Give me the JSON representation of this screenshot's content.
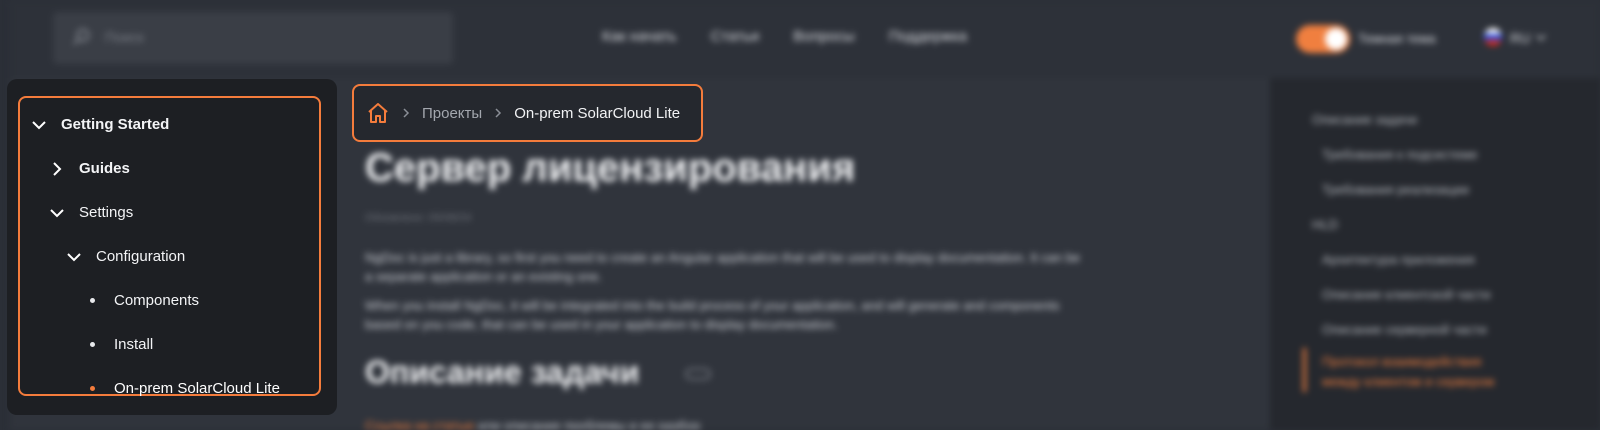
{
  "header": {
    "search_placeholder": "Поиск",
    "nav": [
      "Как начать",
      "Статьи",
      "Вопросы",
      "Поддержка"
    ],
    "theme_label": "Темная тема",
    "language": "RU"
  },
  "breadcrumb": {
    "items": [
      "Проекты",
      "On-prem SolarCloud Lite"
    ]
  },
  "sidebar": {
    "items": [
      {
        "label": "Getting Started",
        "state": "expanded"
      },
      {
        "label": "Guides",
        "state": "collapsed"
      },
      {
        "label": "Settings",
        "state": "expanded"
      },
      {
        "label": "Configuration",
        "state": "expanded"
      },
      {
        "label": "Components",
        "state": "leaf"
      },
      {
        "label": "Install",
        "state": "leaf"
      },
      {
        "label": "On-prem SolarCloud Lite",
        "state": "leaf-active"
      }
    ]
  },
  "content": {
    "title": "Сервер лицензирования",
    "updated": "Обновлено: 05/08/24",
    "paragraphs": [
      "NgDoc is just a library, so first you need to create an Angular application that will be used to display documentation. It can be a separate application or an existing one.",
      "When you install NgDoc, it will be integrated into the build process of your application, and will generate and components based on you code, that can be used in your application to display documentation."
    ],
    "section_title": "Описание задачи",
    "section_intro_link": "Ссылка на статью",
    "section_intro_rest": "или описание проблемы и ее разбор"
  },
  "toc": {
    "items": [
      "Описание задачи",
      "Требования к подсистеме",
      "Требования реализации",
      "HLD",
      "Архитектура приложения",
      "Описание клиентской части",
      "Описание серверной части",
      "Протокол взаимодействия",
      "между клиентом и сервером"
    ]
  },
  "colors": {
    "accent": "#f47c3c",
    "background": "#2b2f37",
    "sidebar": "#1d1f23"
  }
}
